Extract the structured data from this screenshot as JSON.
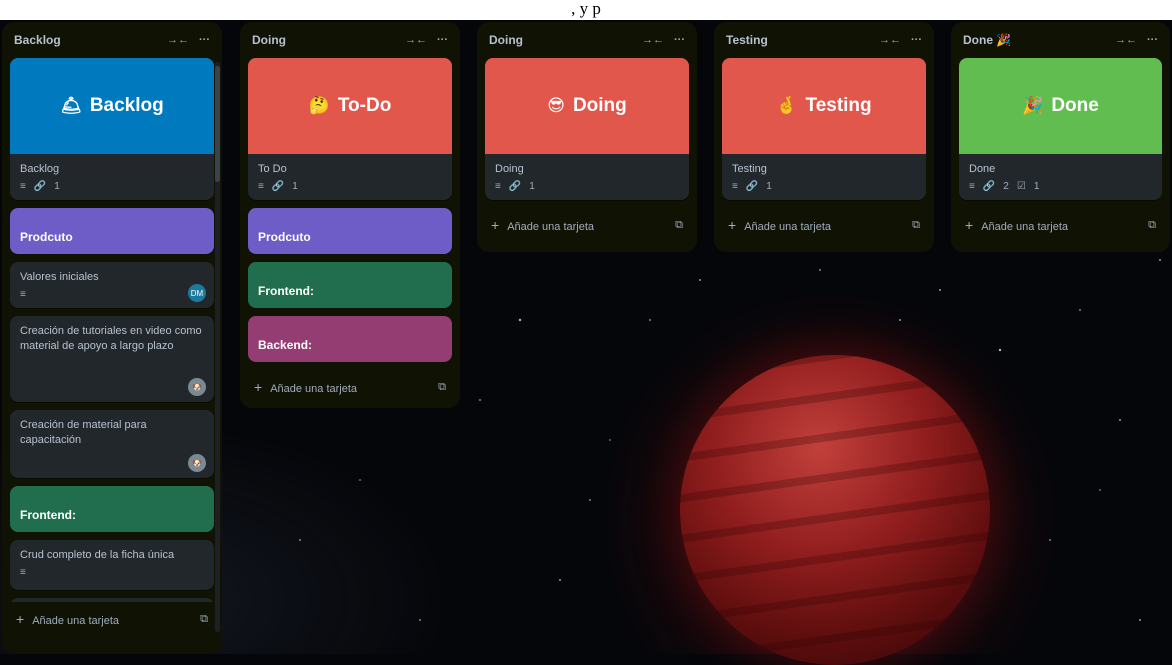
{
  "top_strip_text": ", y p",
  "colors": {
    "list_bg": "#101204",
    "card_bg": "#22272b",
    "cover_blue": "#0079bf",
    "cover_red": "#e2574c",
    "cover_green": "#61bd4f",
    "purple": "#6e5dc6",
    "green": "#216e4e",
    "magenta": "#943d73"
  },
  "lists": {
    "backlog": {
      "title": "Backlog",
      "collapse_icon": "→←",
      "more_icon": "···",
      "cover_card": {
        "emoji": "🛎",
        "cover_text": "Backlog",
        "title": "Backlog",
        "desc_icon": "≡",
        "attach_icon": "🔗",
        "attach_count": "1"
      },
      "label_prodcuto": "Prodcuto",
      "card_valores": {
        "title": "Valores iniciales",
        "desc_icon": "≡",
        "avatar": "DM"
      },
      "card_tutoriales": {
        "title": "Creación de tutoriales en video como material de apoyo a largo plazo",
        "avatar": "🐶"
      },
      "card_material": {
        "title": "Creación de material para capacitación",
        "avatar": "🐶"
      },
      "label_frontend": "Frontend:",
      "card_crud": {
        "title": "Crud completo de la ficha única",
        "desc_icon": "≡"
      },
      "add_card": "Añade una tarjeta"
    },
    "todo": {
      "title": "Doing",
      "collapse_icon": "→←",
      "more_icon": "···",
      "cover_card": {
        "emoji": "🤔",
        "cover_text": "To-Do",
        "title": "To Do",
        "desc_icon": "≡",
        "attach_icon": "🔗",
        "attach_count": "1"
      },
      "label_prodcuto": "Prodcuto",
      "label_frontend": "Frontend:",
      "label_backend": "Backend:",
      "add_card": "Añade una tarjeta"
    },
    "doing": {
      "title": "Doing",
      "collapse_icon": "→←",
      "more_icon": "···",
      "cover_card": {
        "emoji": "😎",
        "cover_text": "Doing",
        "title": "Doing",
        "desc_icon": "≡",
        "attach_icon": "🔗",
        "attach_count": "1"
      },
      "add_card": "Añade una tarjeta"
    },
    "testing": {
      "title": "Testing",
      "collapse_icon": "→←",
      "more_icon": "···",
      "cover_card": {
        "emoji": "🤞",
        "cover_text": "Testing",
        "title": "Testing",
        "desc_icon": "≡",
        "attach_icon": "🔗",
        "attach_count": "1"
      },
      "add_card": "Añade una tarjeta"
    },
    "done": {
      "title": "Done 🎉",
      "collapse_icon": "→←",
      "more_icon": "···",
      "cover_card": {
        "emoji": "🎉",
        "cover_text": "Done",
        "title": "Done",
        "desc_icon": "≡",
        "attach_icon": "🔗",
        "attach_count": "2",
        "checklist_icon": "☑",
        "checklist_count": "1"
      },
      "add_card": "Añade una tarjeta"
    }
  }
}
